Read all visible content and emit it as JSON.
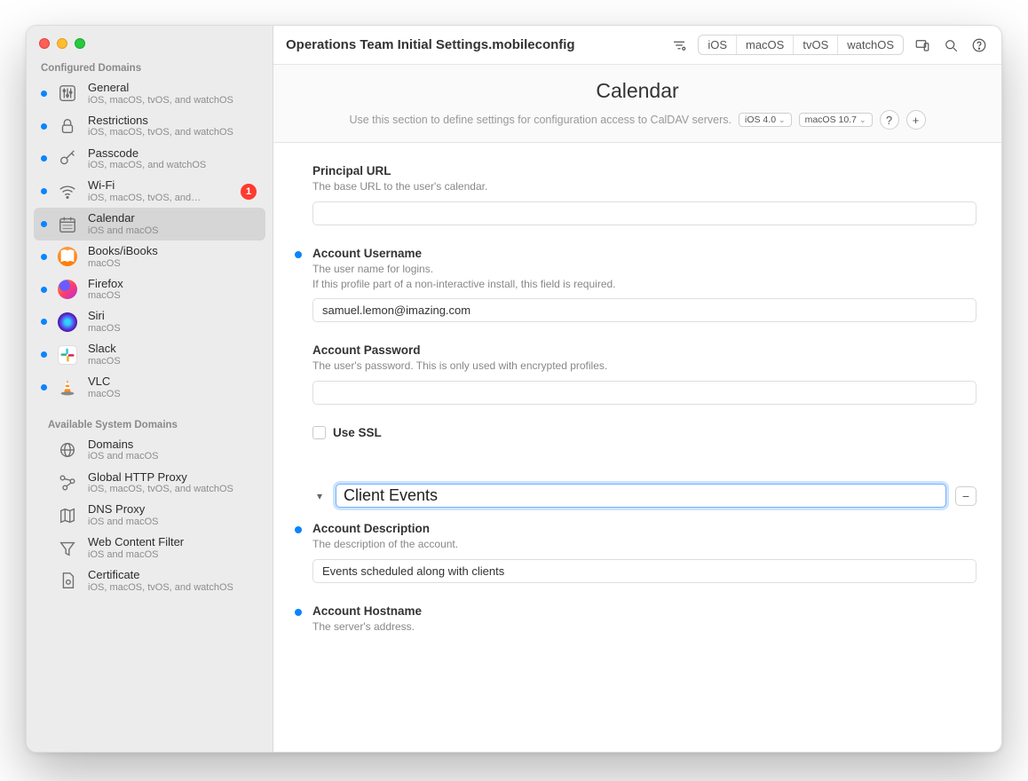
{
  "window": {
    "title": "Operations Team Initial Settings.mobileconfig"
  },
  "platforms": [
    "iOS",
    "macOS",
    "tvOS",
    "watchOS"
  ],
  "sidebar": {
    "configured_header": "Configured Domains",
    "available_header": "Available System Domains",
    "configured": [
      {
        "title": "General",
        "sub": "iOS, macOS, tvOS, and watchOS",
        "icon": "sliders",
        "badge": null
      },
      {
        "title": "Restrictions",
        "sub": "iOS, macOS, tvOS, and watchOS",
        "icon": "lock",
        "badge": null
      },
      {
        "title": "Passcode",
        "sub": "iOS, macOS, and watchOS",
        "icon": "key",
        "badge": null
      },
      {
        "title": "Wi-Fi",
        "sub": "iOS, macOS, tvOS, and…",
        "icon": "wifi",
        "badge": "1"
      },
      {
        "title": "Calendar",
        "sub": "iOS and macOS",
        "icon": "calendar",
        "badge": null
      },
      {
        "title": "Books/iBooks",
        "sub": "macOS",
        "icon": "app-books",
        "badge": null
      },
      {
        "title": "Firefox",
        "sub": "macOS",
        "icon": "app-firefox",
        "badge": null
      },
      {
        "title": "Siri",
        "sub": "macOS",
        "icon": "app-siri",
        "badge": null
      },
      {
        "title": "Slack",
        "sub": "macOS",
        "icon": "app-slack",
        "badge": null
      },
      {
        "title": "VLC",
        "sub": "macOS",
        "icon": "app-vlc",
        "badge": null
      }
    ],
    "available": [
      {
        "title": "Domains",
        "sub": "iOS and macOS",
        "icon": "globe"
      },
      {
        "title": "Global HTTP Proxy",
        "sub": "iOS, macOS, tvOS, and watchOS",
        "icon": "proxy"
      },
      {
        "title": "DNS Proxy",
        "sub": "iOS and macOS",
        "icon": "map"
      },
      {
        "title": "Web Content Filter",
        "sub": "iOS and macOS",
        "icon": "funnel"
      },
      {
        "title": "Certificate",
        "sub": "iOS, macOS, tvOS, and watchOS",
        "icon": "cert"
      }
    ]
  },
  "panel": {
    "heading": "Calendar",
    "subtitle": "Use this section to define settings for configuration access to CalDAV servers.",
    "chip_ios": "iOS  4.0",
    "chip_macos": "macOS  10.7",
    "fields": {
      "principal_url": {
        "label": "Principal URL",
        "desc": "The base URL to the user's calendar.",
        "value": ""
      },
      "username": {
        "label": "Account Username",
        "desc1": "The user name for logins.",
        "desc2": "If this profile part of a non-interactive install, this field is required.",
        "value": "samuel.lemon@imazing.com"
      },
      "password": {
        "label": "Account Password",
        "desc": "The user's password. This is only used with encrypted profiles.",
        "value": ""
      },
      "use_ssl_label": "Use SSL",
      "account_name": "Client Events",
      "description": {
        "label": "Account Description",
        "desc": "The description of the account.",
        "value": "Events scheduled along with clients"
      },
      "hostname": {
        "label": "Account Hostname",
        "desc": "The server's address."
      }
    }
  }
}
